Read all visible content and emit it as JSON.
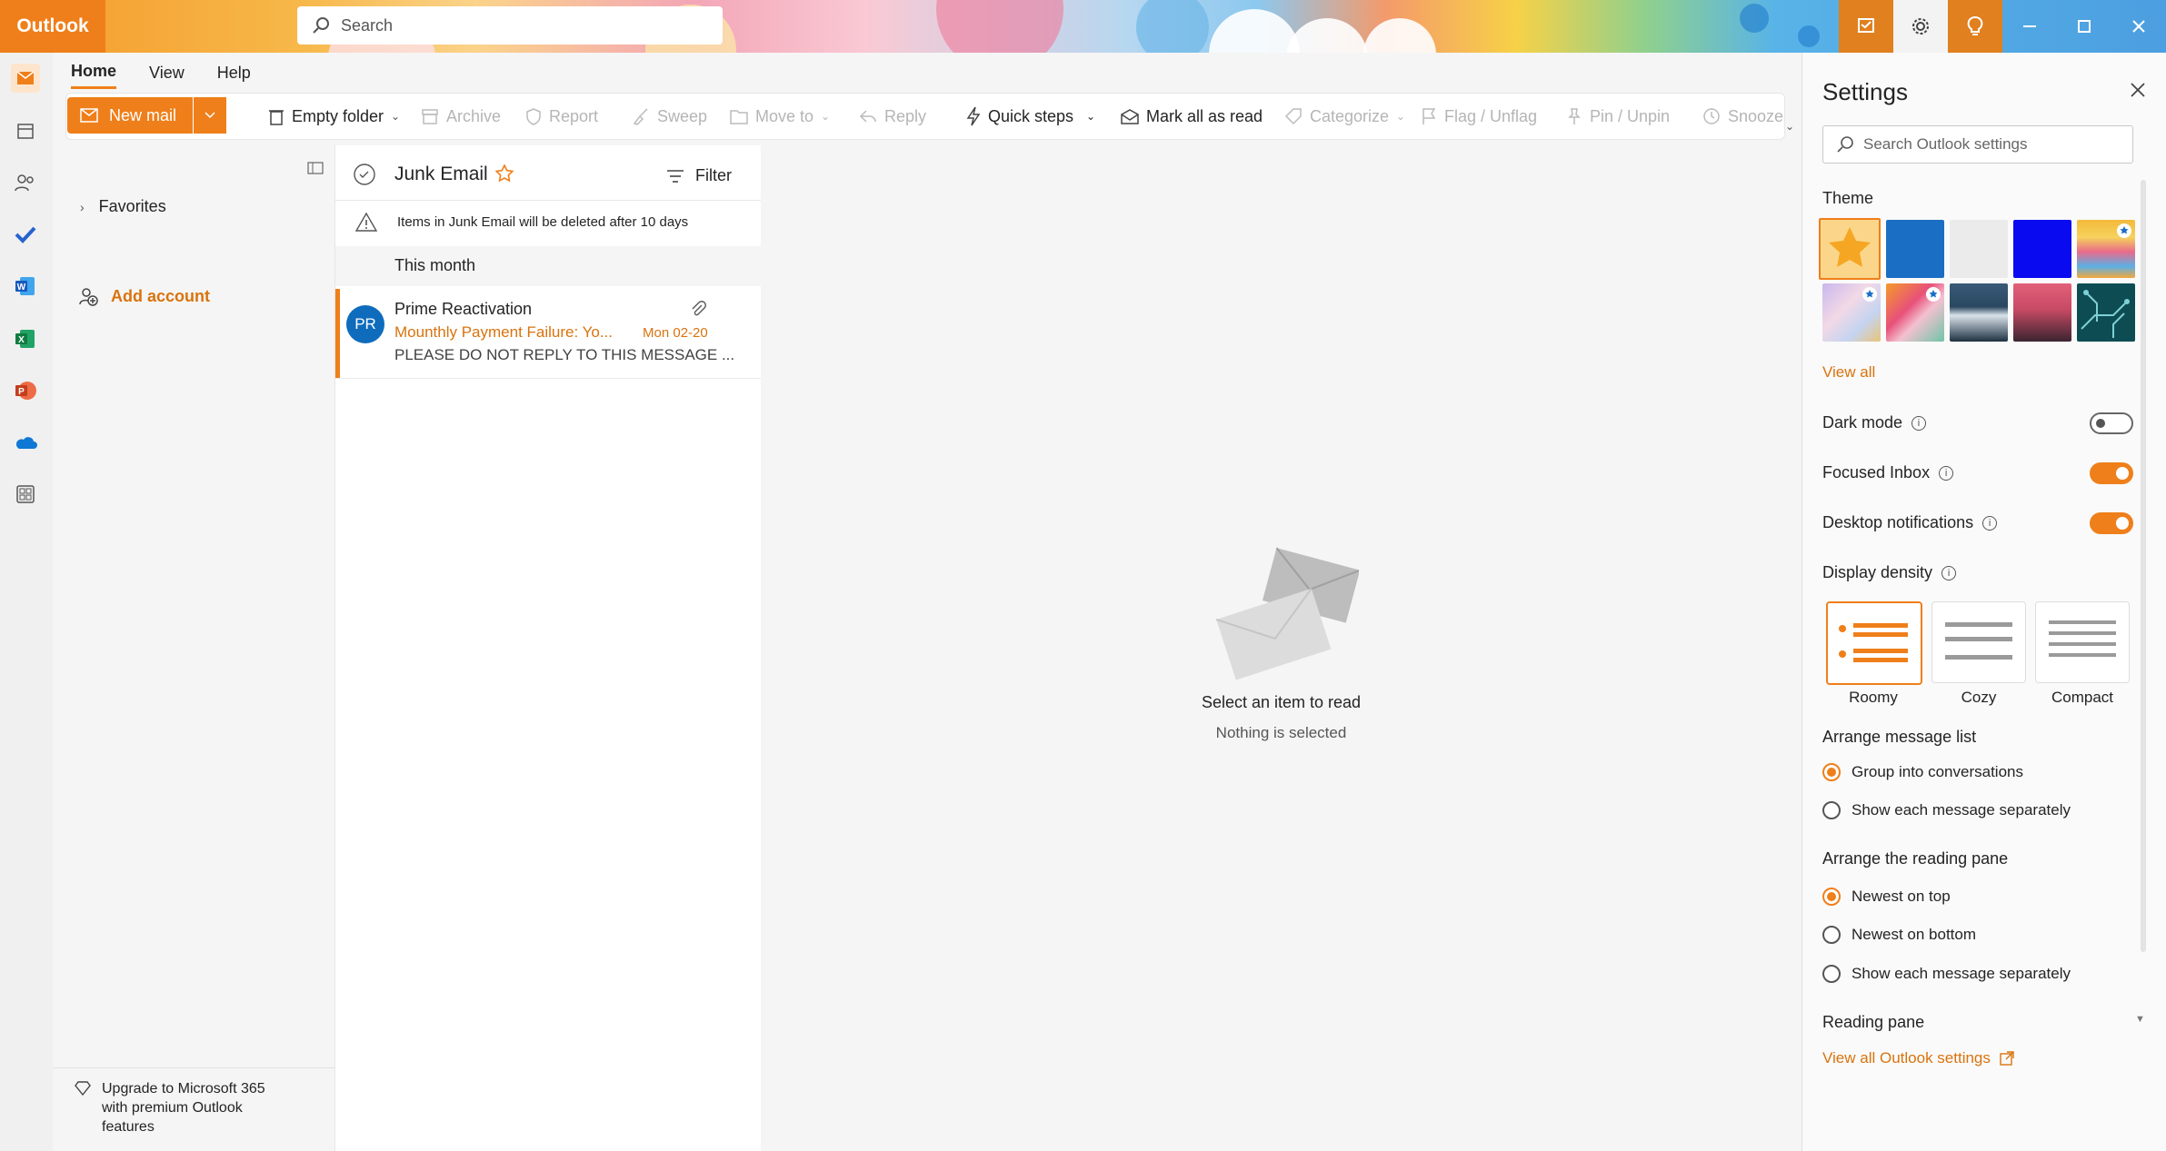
{
  "app": {
    "brand": "Outlook",
    "search_placeholder": "Search"
  },
  "ribbon": {
    "tabs": [
      "Home",
      "View",
      "Help"
    ],
    "new_mail": "New mail",
    "empty_folder": "Empty folder",
    "archive": "Archive",
    "report": "Report",
    "sweep": "Sweep",
    "move_to": "Move to",
    "reply": "Reply",
    "quick_steps": "Quick steps",
    "mark_all_read": "Mark all as read",
    "categorize": "Categorize",
    "flag": "Flag / Unflag",
    "pin": "Pin / Unpin",
    "snooze": "Snooze"
  },
  "folders": {
    "favorites": "Favorites",
    "add_account": "Add account",
    "upgrade_line1": "Upgrade to Microsoft 365",
    "upgrade_line2": "with premium Outlook",
    "upgrade_line3": "features"
  },
  "list": {
    "folder_name": "Junk Email",
    "filter": "Filter",
    "notice": "Items in Junk Email will be deleted after 10 days",
    "group": "This month",
    "message": {
      "initials": "PR",
      "sender": "Prime Reactivation",
      "subject": "Mounthly Payment Failure: Yo...",
      "date": "Mon 02-20",
      "preview": "PLEASE DO NOT REPLY TO THIS MESSAGE ..."
    }
  },
  "reading": {
    "title": "Select an item to read",
    "subtitle": "Nothing is selected"
  },
  "settings": {
    "title": "Settings",
    "search_placeholder": "Search Outlook settings",
    "theme_label": "Theme",
    "view_all": "View all",
    "dark_mode": "Dark mode",
    "dark_mode_on": false,
    "focused_inbox": "Focused Inbox",
    "focused_inbox_on": true,
    "desktop_notifications": "Desktop notifications",
    "desktop_notifications_on": true,
    "display_density": "Display density",
    "density_options": [
      "Roomy",
      "Cozy",
      "Compact"
    ],
    "density_selected": "Roomy",
    "arrange_list_label": "Arrange message list",
    "arrange_list_options": [
      "Group into conversations",
      "Show each message separately"
    ],
    "arrange_pane_label": "Arrange the reading pane",
    "arrange_pane_options": [
      "Newest on top",
      "Newest on bottom",
      "Show each message separately"
    ],
    "reading_pane": "Reading pane",
    "view_all_settings": "View all Outlook settings"
  },
  "colors": {
    "accent": "#ef7f1a",
    "avatar": "#0f6cbd"
  }
}
